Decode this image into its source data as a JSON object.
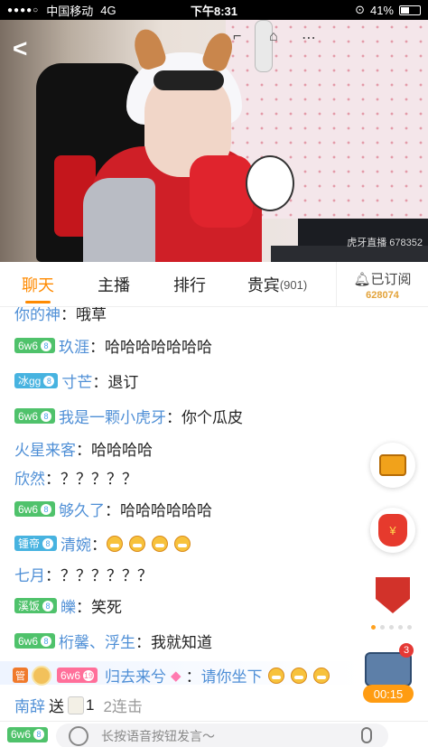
{
  "status_bar": {
    "carrier": "中国移动",
    "network": "4G",
    "time": "下午8:31",
    "battery": "41%",
    "battery_level": 0.41
  },
  "video": {
    "watermark": "虎牙直播 678352"
  },
  "tabs": [
    {
      "label": "聊天",
      "active": true
    },
    {
      "label": "主播",
      "active": false
    },
    {
      "label": "排行",
      "active": false
    },
    {
      "label": "贵宾",
      "count": "(901)",
      "active": false
    }
  ],
  "subscribe": {
    "label": "已订阅",
    "count": "628074"
  },
  "chat": {
    "partial": {
      "nick": "你的神",
      "text": "哦草"
    },
    "messages": [
      {
        "badge": "6w6",
        "badge_color": "#4fc26b",
        "nick": "玖涯",
        "text": "哈哈哈哈哈哈哈"
      },
      {
        "badge": "冰gg",
        "badge_color": "#47b3e0",
        "nick": "寸芒",
        "text": "退订"
      },
      {
        "badge": "6w6",
        "badge_color": "#4fc26b",
        "nick": "我是一颗小虎牙",
        "text": "你个瓜皮"
      },
      {
        "badge": "",
        "nick": "火星来客",
        "text": "哈哈哈哈"
      },
      {
        "badge": "",
        "nick": "欣然",
        "text": "？？？？？"
      },
      {
        "badge": "6w6",
        "badge_color": "#4fc26b",
        "nick": "够久了",
        "text": "哈哈哈哈哈哈"
      },
      {
        "badge": "锺帝",
        "badge_color": "#47b3e0",
        "nick": "清婉",
        "text": ""
      },
      {
        "badge": "",
        "nick": "七月",
        "text": "？？？？？？"
      },
      {
        "badge": "溪饭",
        "badge_color": "#4fc26b",
        "nick": "皪",
        "text": "笑死"
      },
      {
        "badge": "6w6",
        "badge_color": "#4fc26b",
        "nick": "桁馨、浮生",
        "text": "我就知道"
      }
    ],
    "gift_message": {
      "guard": "管",
      "badge": "6w6",
      "nick": "归去来兮",
      "text": "请你坐下"
    },
    "gift_notice": {
      "nick": "南辞",
      "verb": "送",
      "count": "1",
      "combo": "2连击"
    }
  },
  "floating": {
    "box_count": "3",
    "timer": "00:15"
  },
  "input": {
    "badge": "6w6",
    "placeholder": "长按语音按钮发言～"
  },
  "icons": [
    "back-icon",
    "bell-icon",
    "treasure-chest-icon",
    "red-envelope-icon",
    "guild-shield-icon",
    "gift-box-icon",
    "emoji-face-icon",
    "microphone-icon"
  ],
  "colors": {
    "accent": "#ff8a00",
    "nick": "#4f8fd6"
  }
}
